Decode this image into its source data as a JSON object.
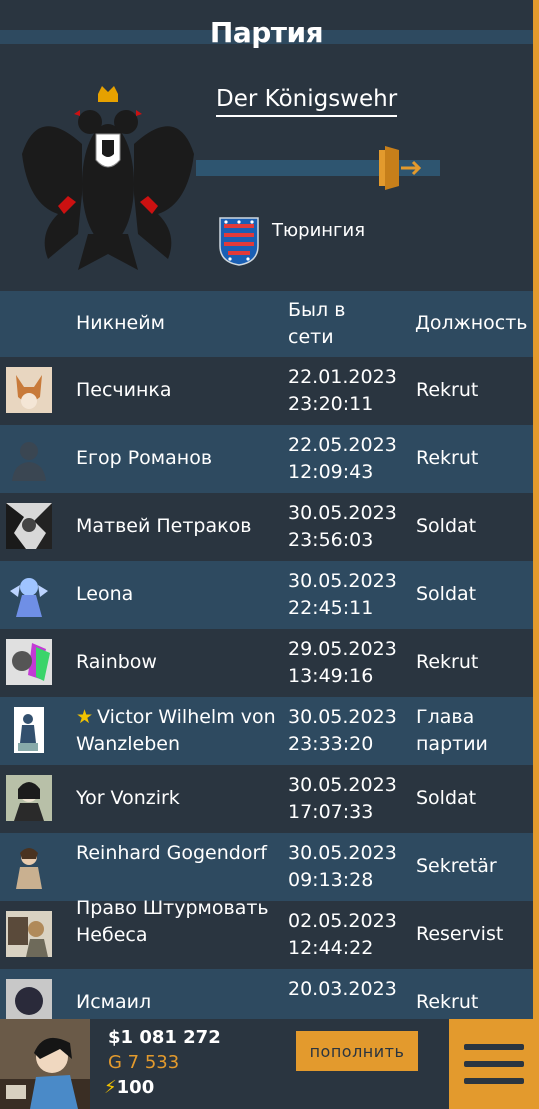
{
  "page": {
    "title": "Партия"
  },
  "party": {
    "name": "Der Königswehr",
    "region": "Тюрингия"
  },
  "table": {
    "headers": {
      "nickname": "Никнейм",
      "last_online": "Был в сети",
      "position": "Должность"
    },
    "rows": [
      {
        "nickname": "Песчинка",
        "date": "22.01.2023",
        "time": "23:20:11",
        "position": "Rekrut"
      },
      {
        "nickname": "Егор Романов",
        "date": "22.05.2023",
        "time": "12:09:43",
        "position": "Rekrut"
      },
      {
        "nickname": "Матвей Петраков",
        "date": "30.05.2023",
        "time": "23:56:03",
        "position": "Soldat"
      },
      {
        "nickname": "Leona",
        "date": "30.05.2023",
        "time": "22:45:11",
        "position": "Soldat"
      },
      {
        "nickname": "Rainbow",
        "date": "29.05.2023",
        "time": "13:49:16",
        "position": "Rekrut"
      },
      {
        "nickname": "Victor Wilhelm von Wanzleben",
        "date": "30.05.2023",
        "time": "23:33:20",
        "position": "Глава партии",
        "leader": true
      },
      {
        "nickname": "Yor Vonzirk",
        "date": "30.05.2023",
        "time": "17:07:33",
        "position": "Soldat"
      },
      {
        "nickname": "Reinhard Gogendorf",
        "date": "30.05.2023",
        "time": "09:13:28",
        "position": "Sekretär"
      },
      {
        "nickname": "Право Штурмовать Небеса",
        "date": "02.05.2023",
        "time": "12:44:22",
        "position": "Reservist"
      },
      {
        "nickname": "Исмаил",
        "date": "20.03.2023",
        "time": "",
        "position": "Rekrut"
      }
    ]
  },
  "footer": {
    "money": "$1 081 272",
    "gold": "G 7 533",
    "energy": "100",
    "topup_label": "пополнить"
  },
  "colors": {
    "background": "#2a3540",
    "stripe": "#2e4a60",
    "accent": "#e39a2d",
    "leader_star": "#f2c300"
  },
  "icons": [
    "eagle-emblem",
    "exit-icon",
    "thuringia-flag",
    "star-icon",
    "lightning-icon",
    "menu-icon"
  ]
}
